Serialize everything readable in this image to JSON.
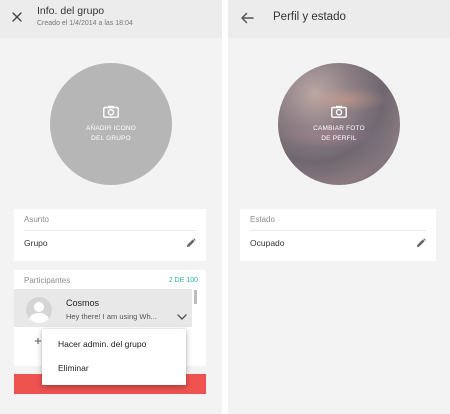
{
  "group_info": {
    "title": "Info. del grupo",
    "subtitle": "Creado el 1/4/2014 a las 18:04",
    "avatar_label_line1": "AÑADIR ICONO",
    "avatar_label_line2": "DEL GRUPO",
    "subject": {
      "label": "Asunto",
      "value": "Grupo"
    },
    "participants": {
      "label": "Participantes",
      "count": "2 DE 100",
      "items": [
        {
          "name": "Cosmos",
          "status": "Hey there! I am using Wh..."
        }
      ]
    },
    "context_menu": {
      "items": [
        "Hacer admin. del grupo",
        "Eliminar"
      ]
    }
  },
  "profile": {
    "title": "Perfil y estado",
    "avatar_label_line1": "CAMBIAR FOTO",
    "avatar_label_line2": "DE PERFIL",
    "status": {
      "label": "Estado",
      "value": "Ocupado"
    }
  },
  "icons": {
    "close": "close-icon",
    "back": "back-arrow-icon",
    "camera": "camera-icon",
    "edit": "pencil-icon",
    "expand": "chevron-down-icon",
    "add_participant": "add-person-icon"
  },
  "colors": {
    "accent_teal": "#2bb0a8",
    "danger_red": "#ef5350",
    "background": "#f3f3f3",
    "appbar": "#ececec"
  }
}
